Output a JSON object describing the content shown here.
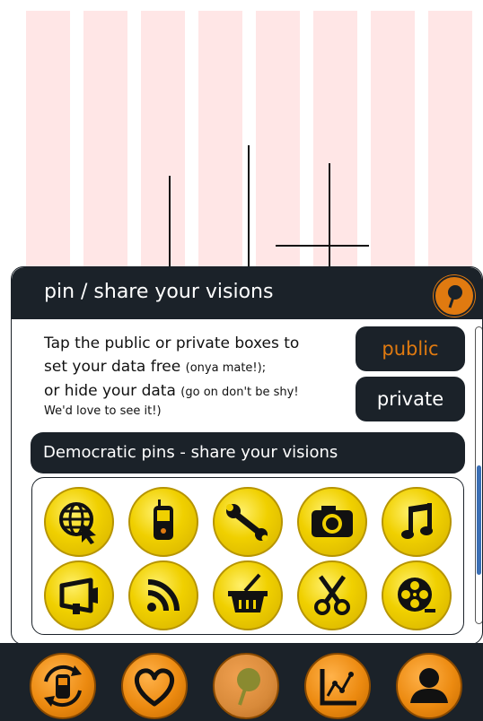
{
  "panel": {
    "title": "pin / share your visions",
    "desc_line1": "Tap the public or private boxes to",
    "desc_line2a": "set your data free ",
    "desc_line2b": "(onya mate!);",
    "desc_line3a": "or hide your data ",
    "desc_line3b": "(go on don't be shy!",
    "desc_line4": "We'd love to see it!)",
    "public_label": "public",
    "private_label": "private",
    "section_label": "Democratic pins -  share your visions"
  },
  "pins": [
    "globe-cursor-icon",
    "mobile-phone-icon",
    "wrench-icon",
    "camera-icon",
    "music-note-icon",
    "megaphone-icon",
    "rss-feed-icon",
    "shopping-basket-icon",
    "scissors-icon",
    "film-reel-icon"
  ],
  "nav": [
    "mobile-sync-icon",
    "heart-icon",
    "pin-icon",
    "line-chart-icon",
    "user-icon"
  ],
  "colors": {
    "dark": "#1b2229",
    "orange": "#e07a10",
    "yellow": "#f0d000",
    "stripe": "#ffe6e6"
  }
}
